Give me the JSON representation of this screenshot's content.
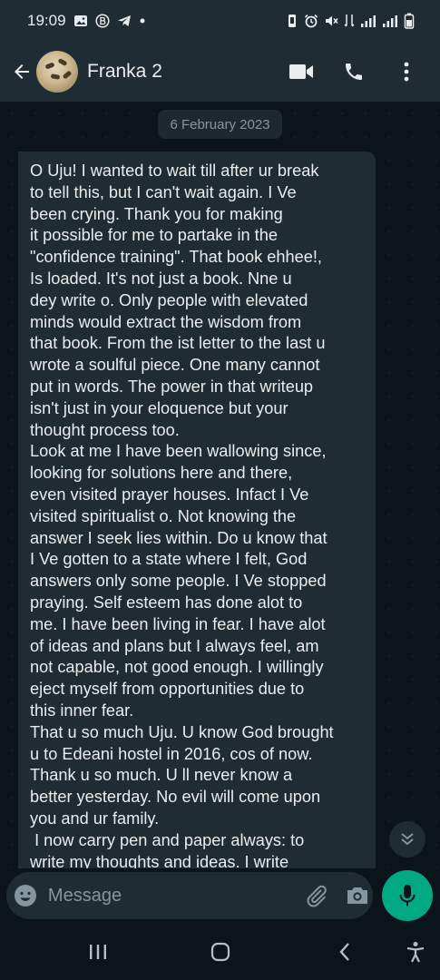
{
  "status_bar": {
    "time": "19:09",
    "left_icons": [
      "gallery-icon",
      "b-circle-icon",
      "telegram-icon",
      "dot-icon"
    ],
    "right_icons": [
      "vibrate-icon",
      "alarm-icon",
      "mute-icon",
      "wifi-calling-icon",
      "signal-icon",
      "signal-icon",
      "battery-icon"
    ]
  },
  "header": {
    "contact_name": "Franka 2",
    "actions": [
      "video-call-icon",
      "phone-icon",
      "more-vert-icon"
    ]
  },
  "chat": {
    "date_divider": "6 February 2023",
    "message_text": "O Uju! I wanted to wait till after ur break\nto tell this, but I can't wait again. I Ve\nbeen crying. Thank you for making\nit possible for me to partake in the\n\"confidence training\". That book ehhee!,\nIs loaded. It's not just a book. Nne u\ndey write o. Only people with elevated\nminds would extract the wisdom from\nthat book. From the ist letter to the last u\nwrote a soulful piece. One many cannot\nput in words. The power in that writeup\nisn't just in your eloquence but your\nthought process too.\nLook at me I have been wallowing since,\nlooking for solutions here and there,\neven visited prayer houses. Infact I Ve\nvisited spiritualist o. Not knowing the\nanswer I seek lies within. Do u know that\nI Ve gotten to a state where I felt, God\nanswers only some people. I Ve stopped\npraying. Self esteem has done alot to\nme. I have been living in fear. I have alot\nof ideas and plans but I always feel, am\nnot capable, not good enough. I willingly\neject myself from opportunities due to\nthis inner fear.\nThat u so much Uju. U know God brought\nu to Edeani hostel in 2016, cos of now.\nThank u so much. U ll never know a\nbetter yesterday. No evil will come upon\nyou and ur family.\n I now carry pen and paper always: to\nwrite my thoughts and ideas. I write"
  },
  "composer": {
    "placeholder": "Message",
    "value": ""
  },
  "colors": {
    "background": "#0b141a",
    "panel": "#1f2c33",
    "accent": "#00a884",
    "text": "#e9edef",
    "muted": "#8696a0"
  }
}
